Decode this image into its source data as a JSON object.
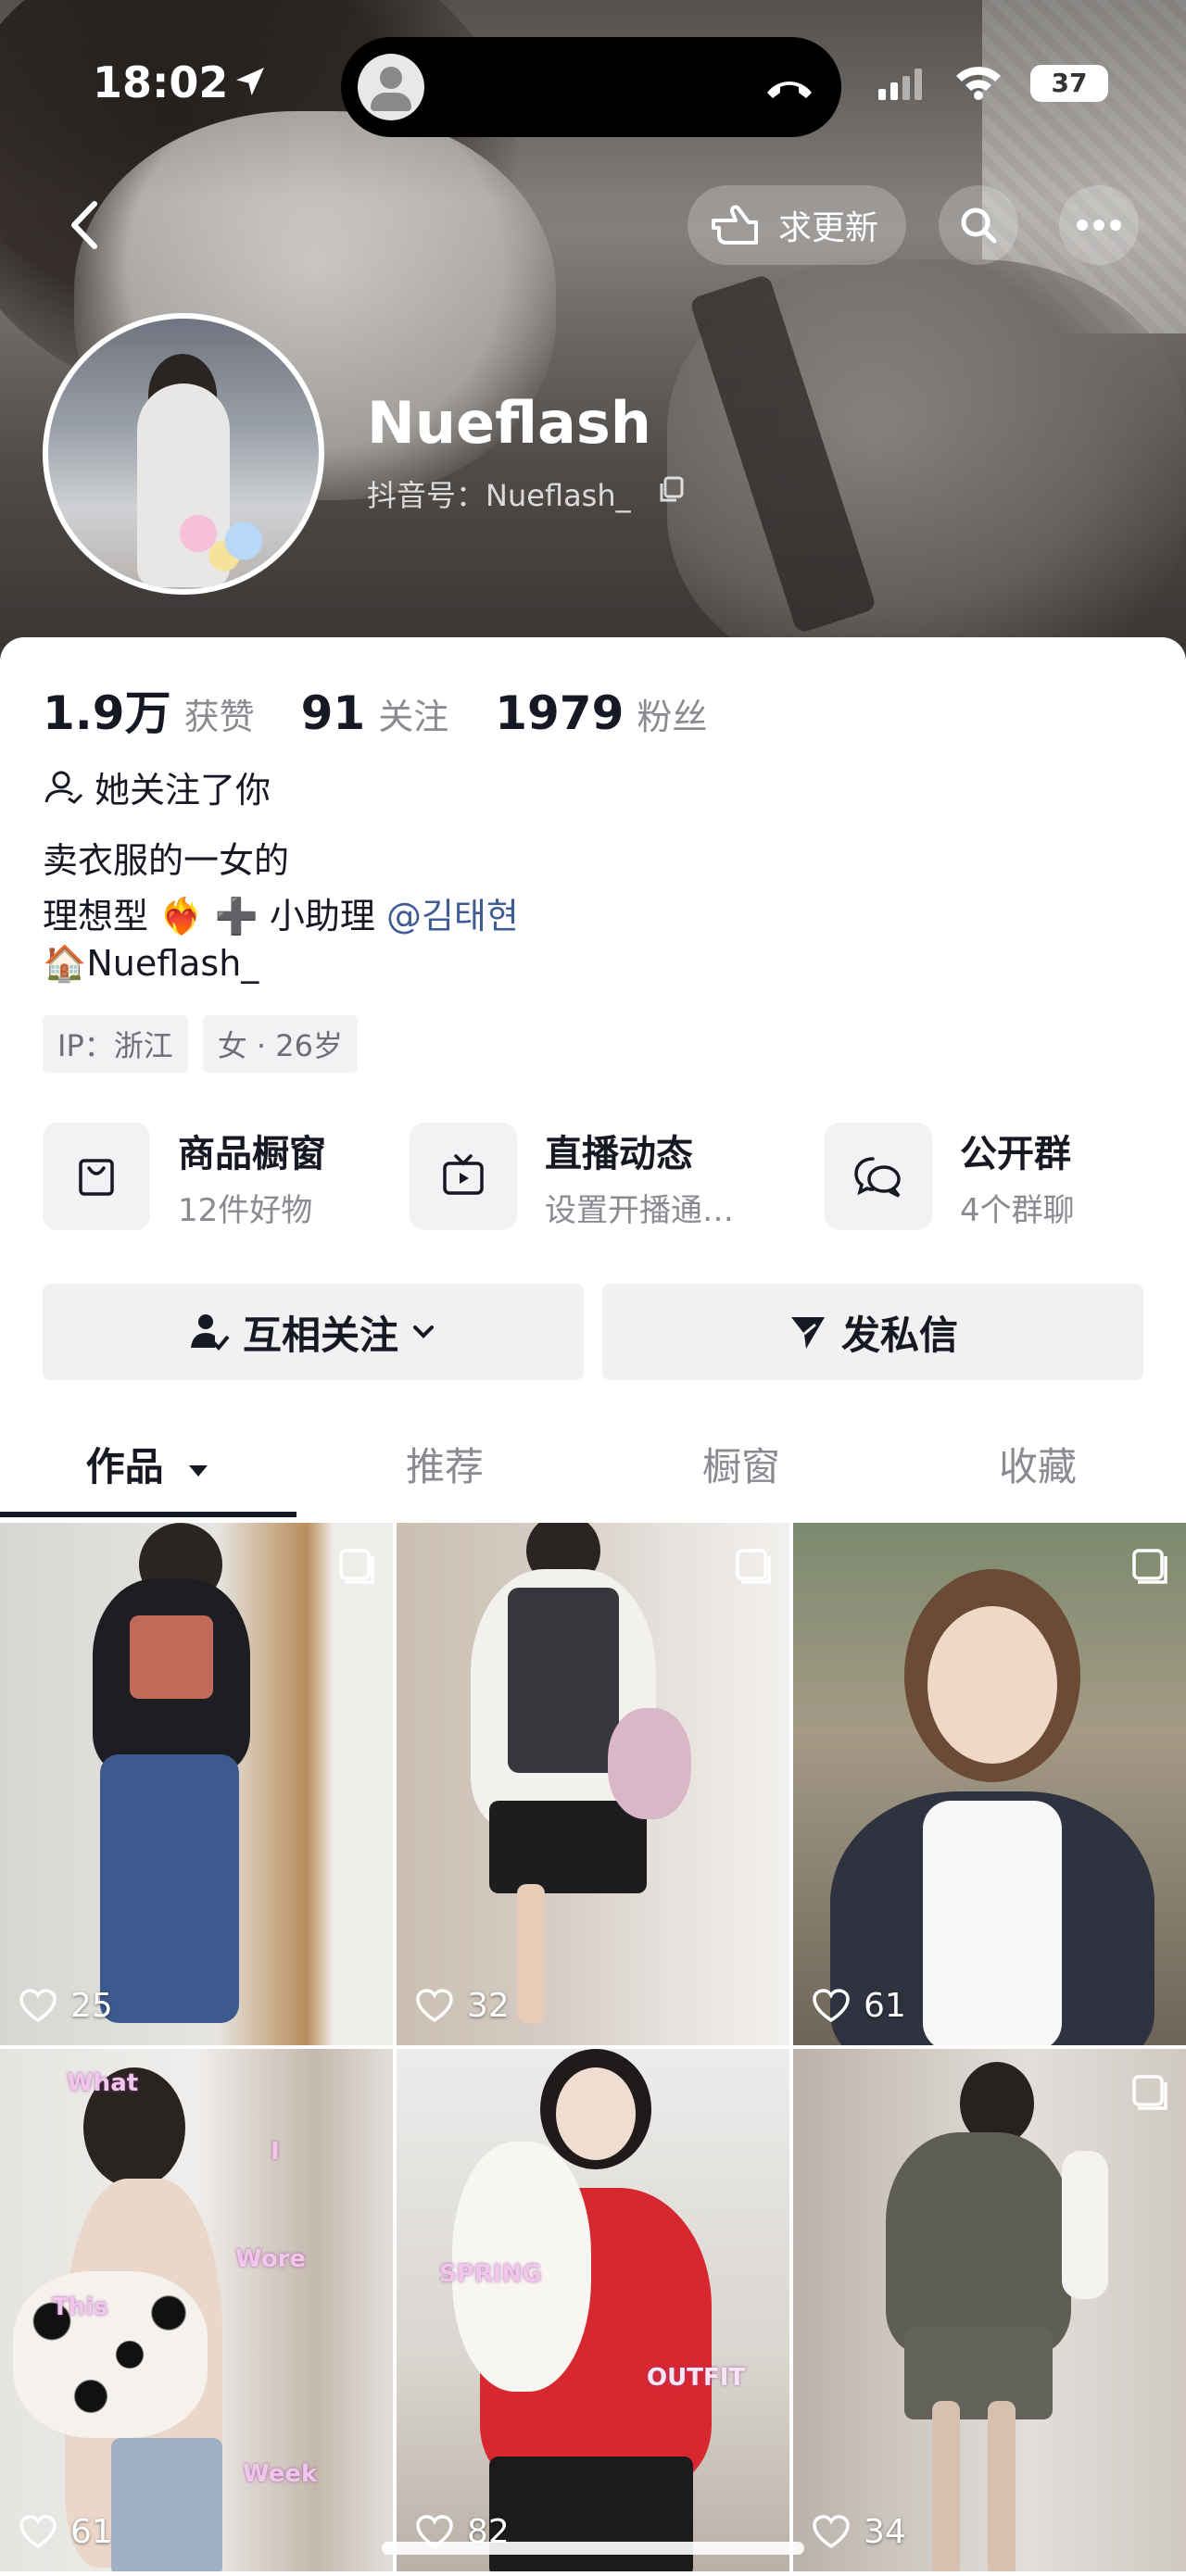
{
  "status_bar": {
    "time": "18:02",
    "battery": "37"
  },
  "nav": {
    "request_update": "求更新"
  },
  "profile": {
    "name": "Nueflash",
    "douyin_id": "抖音号：Nueflash_"
  },
  "stats": [
    {
      "value": "1.9万",
      "label": "获赞"
    },
    {
      "value": "91",
      "label": "关注"
    },
    {
      "value": "1979",
      "label": "粉丝"
    }
  ],
  "follow_status": "她关注了你",
  "bio": {
    "line1": "卖衣服的一女的",
    "line2_prefix": "理想型 ❤️‍🔥 ➕ 小助理 ",
    "line2_mention": "@김태현",
    "line3": "🏠Nueflash_"
  },
  "tags": [
    "IP：浙江",
    "女 · 26岁"
  ],
  "features": [
    {
      "title": "商品橱窗",
      "subtitle": "12件好物",
      "icon": "bag-icon"
    },
    {
      "title": "直播动态",
      "subtitle": "设置开播通…",
      "icon": "tv-icon"
    },
    {
      "title": "公开群",
      "subtitle": "4个群聊",
      "icon": "chat-icon"
    }
  ],
  "actions": {
    "mutual_follow": "互相关注",
    "message": "发私信"
  },
  "tabs": [
    "作品",
    "推荐",
    "橱窗",
    "收藏"
  ],
  "posts": [
    {
      "likes": "25"
    },
    {
      "likes": "32"
    },
    {
      "likes": "61"
    },
    {
      "likes": "61",
      "overlay": [
        "What",
        "I",
        "Wore",
        "This",
        "Week"
      ]
    },
    {
      "likes": "82",
      "overlay": [
        "SPRING",
        "OUTFIT"
      ]
    },
    {
      "likes": "34"
    }
  ]
}
